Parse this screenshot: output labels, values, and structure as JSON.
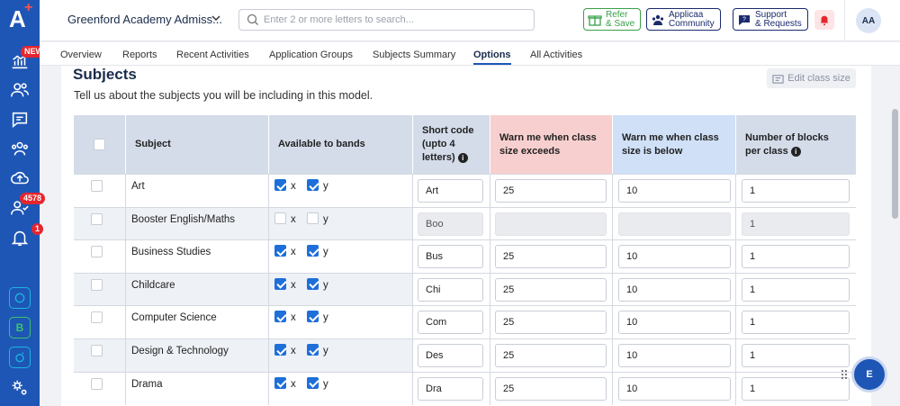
{
  "sidebar": {
    "logo": "A",
    "badges": {
      "new": "NEW",
      "count": "4578",
      "notifications": "1"
    },
    "extras": {
      "b_label": "B"
    }
  },
  "topbar": {
    "app_title": "Greenford Academy Admiss...",
    "search_placeholder": "Enter 2 or more letters to search...",
    "refer_line1": "Refer",
    "refer_line2": "& Save",
    "community_line1": "Applicaa",
    "community_line2": "Community",
    "support_line1": "Support",
    "support_line2": "& Requests",
    "avatar_initials": "AA"
  },
  "tabs": [
    "Overview",
    "Reports",
    "Recent Activities",
    "Application Groups",
    "Subjects Summary",
    "Options",
    "All Activities"
  ],
  "active_tab": "Options",
  "section": {
    "title": "Subjects",
    "description": "Tell us about the subjects you will be including in this model.",
    "edit_button": "Edit class size"
  },
  "table": {
    "headers": {
      "subject": "Subject",
      "bands": "Available to bands",
      "short_code": "Short code (upto 4 letters)",
      "warn_exceeds": "Warn me when class size exceeds",
      "warn_below": "Warn me when class size is below",
      "blocks": "Number of blocks per class"
    },
    "band_labels": [
      "x",
      "y"
    ],
    "rows": [
      {
        "subject": "Art",
        "x": true,
        "y": true,
        "code": "Art",
        "exceeds": "25",
        "below": "10",
        "blocks": "1",
        "disabled": false
      },
      {
        "subject": "Booster English/Maths",
        "x": false,
        "y": false,
        "code": "Boo",
        "exceeds": "",
        "below": "",
        "blocks": "1",
        "disabled": true
      },
      {
        "subject": "Business Studies",
        "x": true,
        "y": true,
        "code": "Bus",
        "exceeds": "25",
        "below": "10",
        "blocks": "1",
        "disabled": false
      },
      {
        "subject": "Childcare",
        "x": true,
        "y": true,
        "code": "Chi",
        "exceeds": "25",
        "below": "10",
        "blocks": "1",
        "disabled": false
      },
      {
        "subject": "Computer Science",
        "x": true,
        "y": true,
        "code": "Com",
        "exceeds": "25",
        "below": "10",
        "blocks": "1",
        "disabled": false
      },
      {
        "subject": "Design & Technology",
        "x": true,
        "y": true,
        "code": "Des",
        "exceeds": "25",
        "below": "10",
        "blocks": "1",
        "disabled": false
      },
      {
        "subject": "Drama",
        "x": true,
        "y": true,
        "code": "Dra",
        "exceeds": "25",
        "below": "10",
        "blocks": "1",
        "disabled": false
      }
    ]
  },
  "fab_label": "E",
  "colors": {
    "sidebar": "#1e56b5",
    "header_default": "#d4dcea",
    "header_exceeds": "#f8cfcf",
    "header_below": "#cfe0f7",
    "checkbox": "#1e6fd9"
  }
}
